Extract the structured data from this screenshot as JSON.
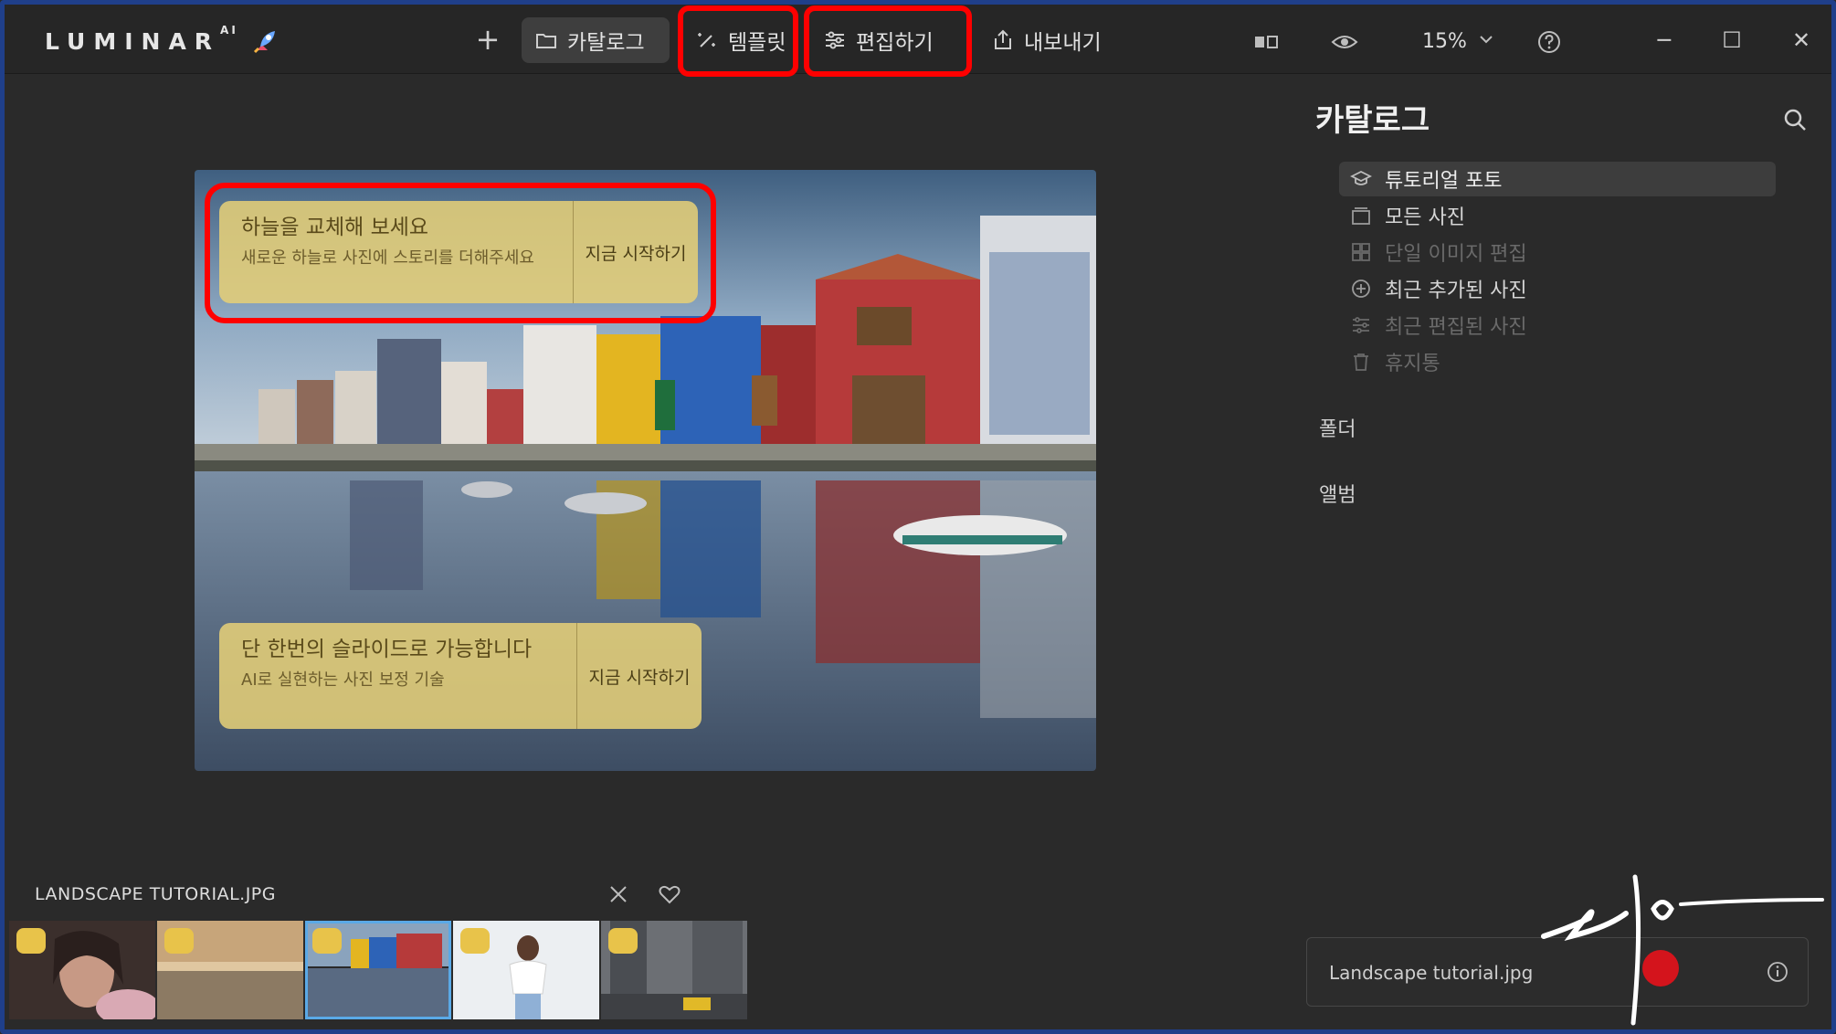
{
  "app": {
    "logo": "LUMINAR",
    "logo_sup": "AI"
  },
  "toolbar": {
    "tabs": [
      {
        "label": "카탈로그",
        "icon": "folder-icon"
      },
      {
        "label": "템플릿",
        "icon": "magic-wand-icon"
      },
      {
        "label": "편집하기",
        "icon": "sliders-icon"
      },
      {
        "label": "내보내기",
        "icon": "export-icon"
      }
    ],
    "zoom": "15%"
  },
  "photo": {
    "card1": {
      "title": "하늘을 교체해 보세요",
      "subtitle": "새로운 하늘로 사진에 스토리를 더해주세요",
      "cta": "지금 시작하기"
    },
    "card2": {
      "title": "단 한번의 슬라이드로 가능합니다",
      "subtitle": "AI로 실현하는 사진 보정 기술",
      "cta": "지금 시작하기"
    }
  },
  "panel": {
    "title": "카탈로그",
    "items": [
      {
        "label": "튜토리얼 포토",
        "icon": "graduation-cap-icon",
        "state": "active"
      },
      {
        "label": "모든 사진",
        "icon": "photos-icon",
        "state": "on"
      },
      {
        "label": "단일 이미지 편집",
        "icon": "grid-icon",
        "state": "dim"
      },
      {
        "label": "최근 추가된 사진",
        "icon": "plus-circle-icon",
        "state": "on"
      },
      {
        "label": "최근 편집된 사진",
        "icon": "sliders-icon",
        "state": "dim"
      },
      {
        "label": "휴지통",
        "icon": "trash-icon",
        "state": "dim"
      }
    ],
    "sections": [
      "폴더",
      "앨범"
    ]
  },
  "filmstrip": {
    "title": "LANDSCAPE TUTORIAL.JPG",
    "selected_index": 2
  },
  "infobox": {
    "filename": "Landscape tutorial.jpg"
  },
  "colors": {
    "highlight": "#ff0000",
    "accent": "#5aa9e6",
    "card": "#e4ce78",
    "frame": "#1f3f8a"
  }
}
